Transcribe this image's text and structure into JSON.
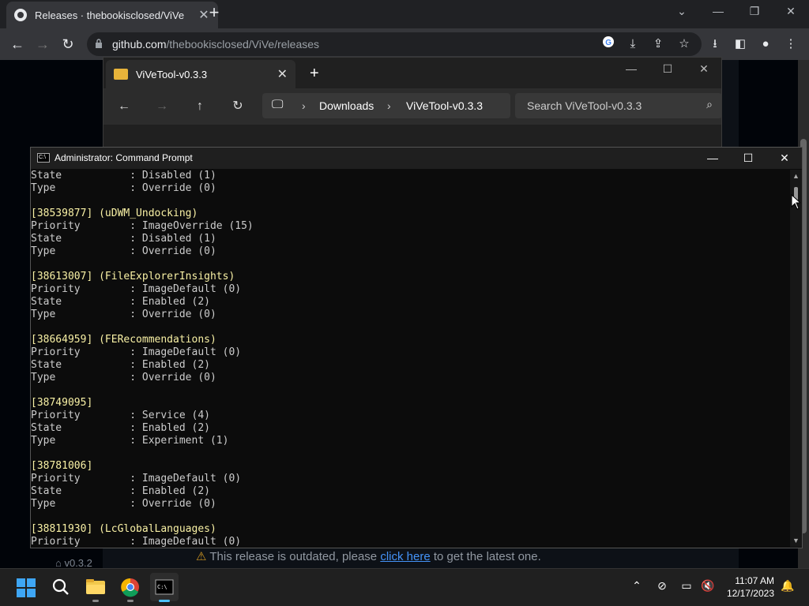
{
  "browser": {
    "tab_title": "Releases · thebookisclosed/ViVe",
    "url_host": "github.com",
    "url_path": "/thebookisclosed/ViVe/releases",
    "icons": [
      "github-icon",
      "close-icon",
      "plus-icon",
      "back-icon",
      "forward-icon",
      "reload-icon",
      "lock-icon",
      "google-icon",
      "install-icon",
      "share-icon",
      "star-icon",
      "download-icon",
      "sidebar-icon",
      "profile-icon",
      "menu-icon"
    ]
  },
  "github": {
    "tag_label": "v0.3.2",
    "warning_prefix": "This release is outdated, please ",
    "warning_link": "click here",
    "warning_suffix": " to get the latest one.",
    "warning_icon": "⚠"
  },
  "explorer": {
    "tab_title": "ViVeTool-v0.3.3",
    "breadcrumb": [
      "Downloads",
      "ViVeTool-v0.3.3"
    ],
    "search_placeholder": "Search ViVeTool-v0.3.3"
  },
  "cmd": {
    "title": "Administrator: Command Prompt",
    "lines": [
      {
        "t": "State           : Disabled (1)",
        "h": false
      },
      {
        "t": "Type            : Override (0)",
        "h": false
      },
      {
        "t": "",
        "h": false
      },
      {
        "t": "[38539877] (uDWM_Undocking)",
        "h": true
      },
      {
        "t": "Priority        : ImageOverride (15)",
        "h": false
      },
      {
        "t": "State           : Disabled (1)",
        "h": false
      },
      {
        "t": "Type            : Override (0)",
        "h": false
      },
      {
        "t": "",
        "h": false
      },
      {
        "t": "[38613007] (FileExplorerInsights)",
        "h": true
      },
      {
        "t": "Priority        : ImageDefault (0)",
        "h": false
      },
      {
        "t": "State           : Enabled (2)",
        "h": false
      },
      {
        "t": "Type            : Override (0)",
        "h": false
      },
      {
        "t": "",
        "h": false
      },
      {
        "t": "[38664959] (FERecommendations)",
        "h": true
      },
      {
        "t": "Priority        : ImageDefault (0)",
        "h": false
      },
      {
        "t": "State           : Enabled (2)",
        "h": false
      },
      {
        "t": "Type            : Override (0)",
        "h": false
      },
      {
        "t": "",
        "h": false
      },
      {
        "t": "[38749095]",
        "h": true
      },
      {
        "t": "Priority        : Service (4)",
        "h": false
      },
      {
        "t": "State           : Enabled (2)",
        "h": false
      },
      {
        "t": "Type            : Experiment (1)",
        "h": false
      },
      {
        "t": "",
        "h": false
      },
      {
        "t": "[38781006]",
        "h": true
      },
      {
        "t": "Priority        : ImageDefault (0)",
        "h": false
      },
      {
        "t": "State           : Enabled (2)",
        "h": false
      },
      {
        "t": "Type            : Override (0)",
        "h": false
      },
      {
        "t": "",
        "h": false
      },
      {
        "t": "[38811930] (LcGlobalLanguages)",
        "h": true
      },
      {
        "t": "Priority        : ImageDefault (0)",
        "h": false
      }
    ]
  },
  "taskbar": {
    "time": "11:07 AM",
    "date": "12/17/2023",
    "apps": [
      "start",
      "search",
      "file-explorer",
      "chrome",
      "terminal"
    ]
  },
  "colors": {
    "cmd_header": "#f9f1a5",
    "accent": "#4cc2ff",
    "link": "#4493f8"
  }
}
